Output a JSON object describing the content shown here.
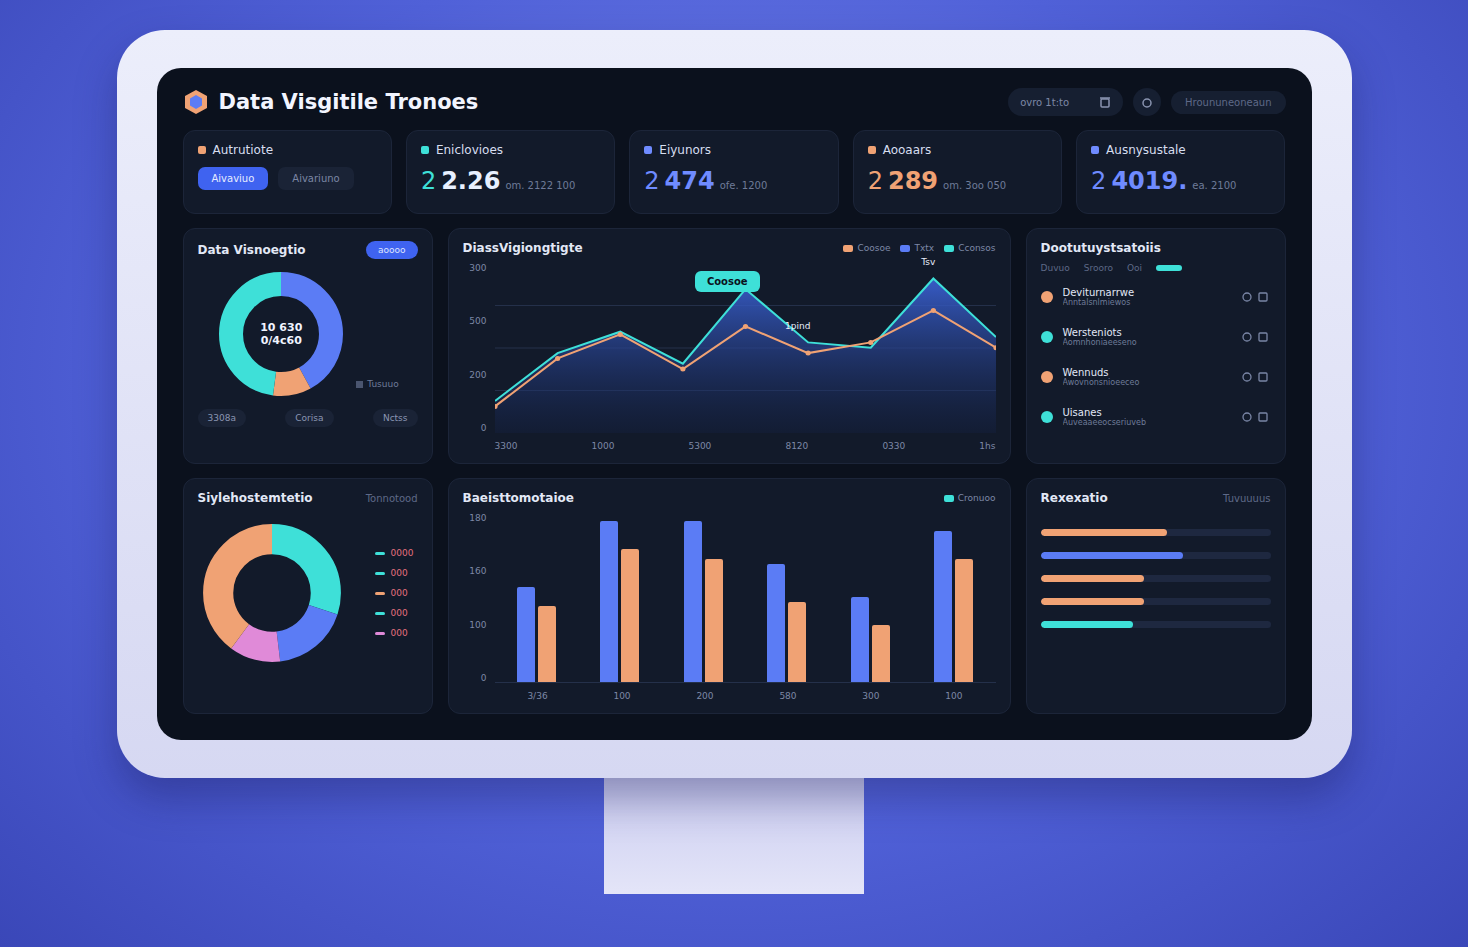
{
  "header": {
    "logo": "Data Visgitile Tronoes",
    "search": {
      "placeholder": "ovro 1t:to"
    },
    "pill": "Hroununeoneaun"
  },
  "kpis": [
    {
      "title": "Autrutiote",
      "kind": "buttons",
      "buttons": [
        {
          "label": "Aivaviuo",
          "selected": true
        },
        {
          "label": "Aivariuno",
          "selected": false
        }
      ]
    },
    {
      "title": "Eniclovioes",
      "kind": "value",
      "prefix": "2",
      "value": "2.26",
      "sub": "om. 2122 100",
      "color": "#3ee0d8"
    },
    {
      "title": "Eiyunors",
      "kind": "value",
      "prefix": "2",
      "value": "474",
      "sub": "ofe. 1200",
      "color": "#6f8bff"
    },
    {
      "title": "Aooaars",
      "kind": "value",
      "prefix": "2",
      "value": "289",
      "sub": "om. 3oo 050",
      "color": "#f0a274"
    },
    {
      "title": "Ausnysustale",
      "kind": "value",
      "prefix": "2",
      "value": "4019.",
      "sub": "ea. 2100",
      "color": "#6f8bff"
    }
  ],
  "donut_top": {
    "title": "Data Visnoegtio",
    "badge": "aoooo",
    "center": [
      "10 630",
      "0/4c60"
    ],
    "legend": "Tusuuo",
    "segments": [
      {
        "value": 42,
        "color": "#5b7cf5"
      },
      {
        "value": 10,
        "color": "#f0a274"
      },
      {
        "value": 48,
        "color": "#3ee0d8"
      }
    ],
    "buttons": [
      "3308a",
      "Corisa",
      "Nctss"
    ]
  },
  "line_chart": {
    "title": "DiassVigiongtigte",
    "legend": [
      {
        "label": "Coosoe",
        "color": "#f0a274"
      },
      {
        "label": "Txtx",
        "color": "#5b7cf5"
      },
      {
        "label": "Cconsos",
        "color": "#3ee0d8"
      }
    ],
    "y_ticks": [
      "300",
      "500",
      "200",
      "0"
    ],
    "x_ticks": [
      "3300",
      "1000",
      "5300",
      "8120",
      "0330",
      "1hs"
    ],
    "tooltip": "Coosoe",
    "peak_label": "1pind",
    "top_label": "Tsv",
    "series": [
      {
        "name": "area",
        "color": "#5b7cf5",
        "values": [
          60,
          150,
          190,
          130,
          270,
          170,
          160,
          290,
          180
        ]
      },
      {
        "name": "line",
        "color": "#f0a274",
        "values": [
          50,
          140,
          185,
          120,
          200,
          150,
          170,
          230,
          160
        ]
      }
    ]
  },
  "device_list": {
    "title": "Dootutuystsatoiis",
    "tabs": [
      "Duvuo",
      "Srooro",
      "Ooi"
    ],
    "items": [
      {
        "name": "Deviturnarrwe",
        "sub": "Anntalsnlmiewos",
        "color": "#f0a274"
      },
      {
        "name": "Wersteniots",
        "sub": "Aomnhoniaeeseno",
        "color": "#3ee0d8"
      },
      {
        "name": "Wennuds",
        "sub": "Awovnonsnioeeceo",
        "color": "#f0a274"
      },
      {
        "name": "Uisanes",
        "sub": "Auveaaeeocseriuveb",
        "color": "#3ee0d8"
      }
    ]
  },
  "donut_bottom": {
    "title": "Siylehostemtetio",
    "note": "Tonnotood",
    "segments": [
      {
        "value": 30,
        "color": "#3ee0d8"
      },
      {
        "value": 18,
        "color": "#5b7cf5"
      },
      {
        "value": 12,
        "color": "#e08ad8"
      },
      {
        "value": 40,
        "color": "#f0a274"
      }
    ],
    "legend": [
      {
        "label": "0000",
        "color": "#3ee0d8"
      },
      {
        "label": "000",
        "color": "#3ee0d8"
      },
      {
        "label": "000",
        "color": "#f0a274"
      },
      {
        "label": "000",
        "color": "#3ee0d8"
      },
      {
        "label": "000",
        "color": "#e08ad8"
      }
    ]
  },
  "bar_chart": {
    "title": "Baeisttomotaioe",
    "legend": "Cronuoo",
    "y_ticks": [
      "180",
      "160",
      "100",
      "0"
    ],
    "x_ticks": [
      "3/36",
      "100",
      "200",
      "580",
      "300",
      "100"
    ],
    "series": [
      {
        "name": "a",
        "color": "#5b7cf5",
        "values": [
          100,
          170,
          170,
          125,
          90,
          160
        ]
      },
      {
        "name": "b",
        "color": "#f0a274",
        "values": [
          80,
          140,
          130,
          85,
          60,
          130
        ]
      }
    ]
  },
  "progress": {
    "title": "Rexexatio",
    "note": "Tuvuuuus",
    "rows": [
      {
        "level": 0.55,
        "color": "#f0a274"
      },
      {
        "level": 0.62,
        "color": "#5b7cf5"
      },
      {
        "level": 0.45,
        "color": "#f0a274"
      },
      {
        "level": 0.45,
        "color": "#f0a274"
      },
      {
        "level": 0.4,
        "color": "#3ee0d8"
      }
    ]
  }
}
